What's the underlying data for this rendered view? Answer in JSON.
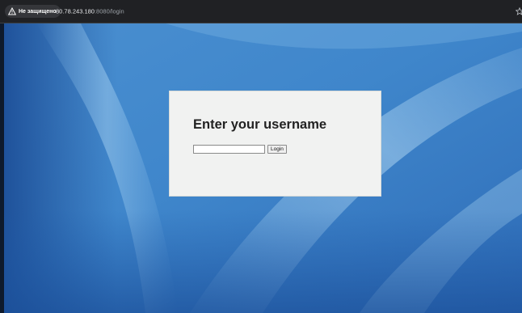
{
  "browser": {
    "security_label": "Не защищено",
    "url_host": "80.78.243.180",
    "url_port": ":8080",
    "url_path": "/login",
    "icons": {
      "security": "warning-triangle-icon",
      "bookmark": "star-icon"
    }
  },
  "page": {
    "title": "Enter your username",
    "username_value": "",
    "login_button": "Login"
  },
  "colors": {
    "toolbar": "#202124",
    "wallpaper_blue": "#3c7fc4",
    "card_background": "#f1f2f1"
  }
}
